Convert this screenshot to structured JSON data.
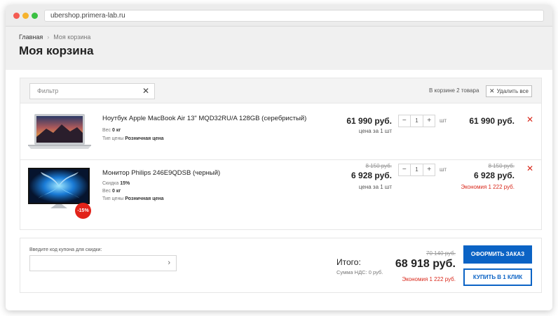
{
  "browser": {
    "url": "ubershop.primera-lab.ru"
  },
  "breadcrumb": {
    "home": "Главная",
    "separator": "›",
    "current": "Моя корзина"
  },
  "page_title": "Моя корзина",
  "basket": {
    "filter_placeholder": "Фильтр",
    "filter_clear": "✕",
    "count_text": "В корзине 2 товара",
    "delete_all_icon": "✕",
    "delete_all_label": "Удалить все",
    "unit": "шт",
    "remove_icon": "✕",
    "items": [
      {
        "name": "Ноутбук Apple MacBook Air 13\" MQD32RU/A 128GB (серебристый)",
        "props": [
          {
            "label": "Вес",
            "value": "0 кг"
          },
          {
            "label": "Тип цены",
            "value": "Розничная цена"
          }
        ],
        "price": "61 990 руб.",
        "price_per_unit": "цена за 1 шт",
        "quantity": "1",
        "sum": "61 990 руб."
      },
      {
        "name": "Монитор Philips 246E9QDSB (черный)",
        "discount_badge": "-15%",
        "props": [
          {
            "label": "Скидка",
            "value": "15%"
          },
          {
            "label": "Вес",
            "value": "0 кг"
          },
          {
            "label": "Тип цены",
            "value": "Розничная цена"
          }
        ],
        "price_old": "8 150 руб.",
        "price": "6 928 руб.",
        "price_per_unit": "цена за 1 шт",
        "quantity": "1",
        "sum_old": "8 150 руб.",
        "sum": "6 928 руб.",
        "economy": "Экономия 1 222 руб."
      }
    ]
  },
  "summary": {
    "coupon_label": "Введите код купона для скидки:",
    "coupon_value": "",
    "total_label": "Итого:",
    "vat_label": "Сумма НДС: 0 руб.",
    "total_old": "70 140 руб.",
    "total": "68 918 руб.",
    "economy": "Экономия 1 222 руб.",
    "order_button": "ОФОРМИТЬ ЗАКАЗ",
    "one_click_button": "КУПИТЬ В 1 КЛИК"
  },
  "colors": {
    "accent": "#0b63c5",
    "danger": "#d9281b",
    "header_bg": "#f0f0f0"
  }
}
